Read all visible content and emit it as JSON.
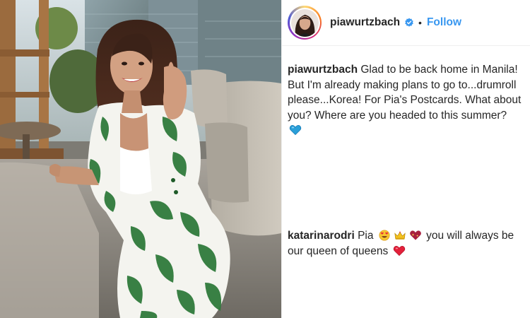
{
  "header": {
    "username": "piawurtzbach",
    "separator": "•",
    "follow_label": "Follow",
    "verified_icon": "verified-badge-icon",
    "accent_color": "#3897f0"
  },
  "caption": {
    "username": "piawurtzbach",
    "text": "Glad to be back home in Manila! But I'm already making plans to go to...drumroll please...Korea! For Pia's Postcards. What about you? Where are you headed to this summer?",
    "trailing_emoji": "blue-heart-icon"
  },
  "comments": [
    {
      "username": "katarinarodri",
      "text_before": "Pia",
      "emojis": [
        "heart-eyes-icon",
        "crown-icon",
        "sparkling-heart-icon"
      ],
      "text_after": "you will always be our queen of queens",
      "trailing_emoji": "red-heart-icon"
    }
  ]
}
